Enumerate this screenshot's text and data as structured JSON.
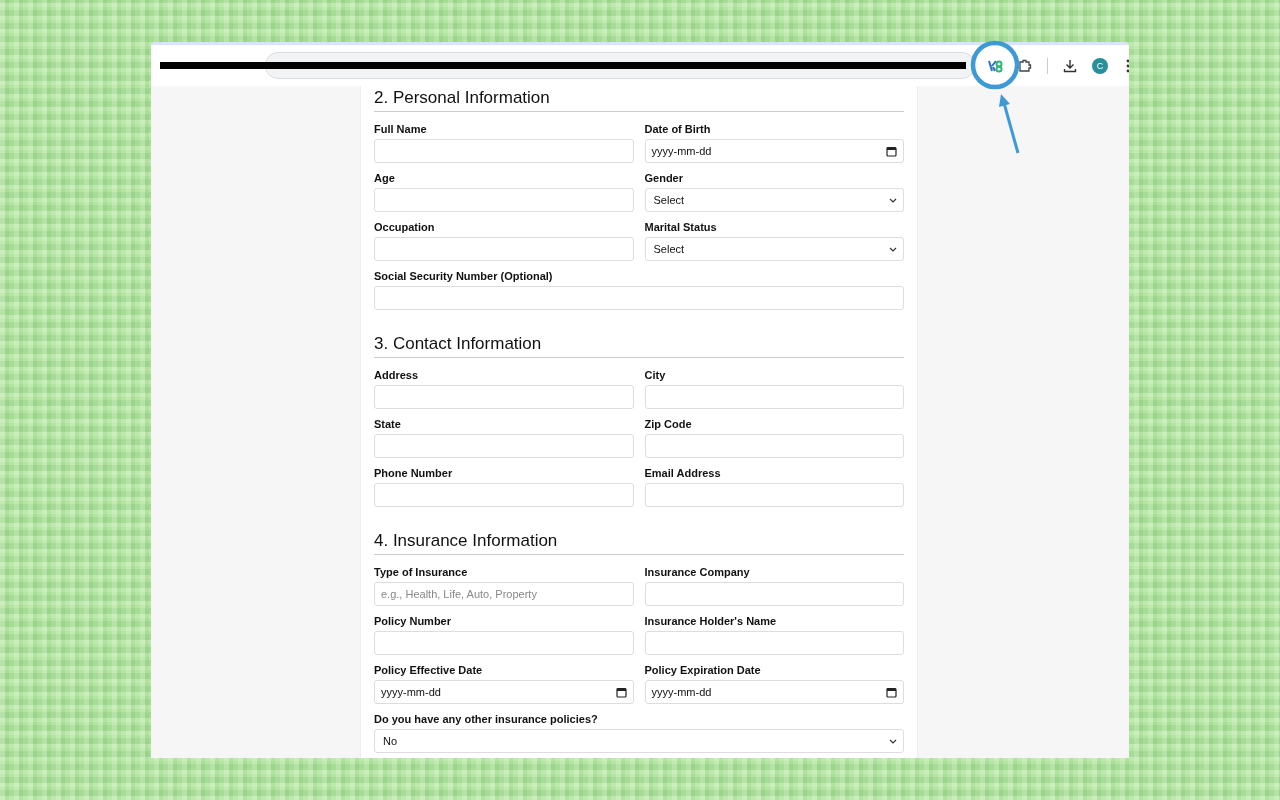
{
  "browser": {
    "profile_initial": "C"
  },
  "sections": [
    {
      "title": "2. Personal Information",
      "fields": [
        {
          "label": "Full Name",
          "kind": "text",
          "full_width": false
        },
        {
          "label": "Date of Birth",
          "kind": "date",
          "full_width": false,
          "placeholder": "yyyy-mm-dd"
        },
        {
          "label": "Age",
          "kind": "text",
          "full_width": false
        },
        {
          "label": "Gender",
          "kind": "select",
          "full_width": false,
          "value": "Select"
        },
        {
          "label": "Occupation",
          "kind": "text",
          "full_width": false
        },
        {
          "label": "Marital Status",
          "kind": "select",
          "full_width": false,
          "value": "Select"
        },
        {
          "label": "Social Security Number (Optional)",
          "kind": "text",
          "full_width": true
        }
      ]
    },
    {
      "title": "3. Contact Information",
      "fields": [
        {
          "label": "Address",
          "kind": "text",
          "full_width": false
        },
        {
          "label": "City",
          "kind": "text",
          "full_width": false
        },
        {
          "label": "State",
          "kind": "text",
          "full_width": false
        },
        {
          "label": "Zip Code",
          "kind": "text",
          "full_width": false
        },
        {
          "label": "Phone Number",
          "kind": "text",
          "full_width": false
        },
        {
          "label": "Email Address",
          "kind": "text",
          "full_width": false
        }
      ]
    },
    {
      "title": "4. Insurance Information",
      "fields": [
        {
          "label": "Type of Insurance",
          "kind": "text",
          "full_width": false,
          "placeholder": "e.g., Health, Life, Auto, Property"
        },
        {
          "label": "Insurance Company",
          "kind": "text",
          "full_width": false
        },
        {
          "label": "Policy Number",
          "kind": "text",
          "full_width": false
        },
        {
          "label": "Insurance Holder's Name",
          "kind": "text",
          "full_width": false
        },
        {
          "label": "Policy Effective Date",
          "kind": "date",
          "full_width": false,
          "placeholder": "yyyy-mm-dd"
        },
        {
          "label": "Policy Expiration Date",
          "kind": "date",
          "full_width": false,
          "placeholder": "yyyy-mm-dd"
        },
        {
          "label": "Do you have any other insurance policies?",
          "kind": "select",
          "full_width": true,
          "value": "No"
        }
      ]
    }
  ]
}
